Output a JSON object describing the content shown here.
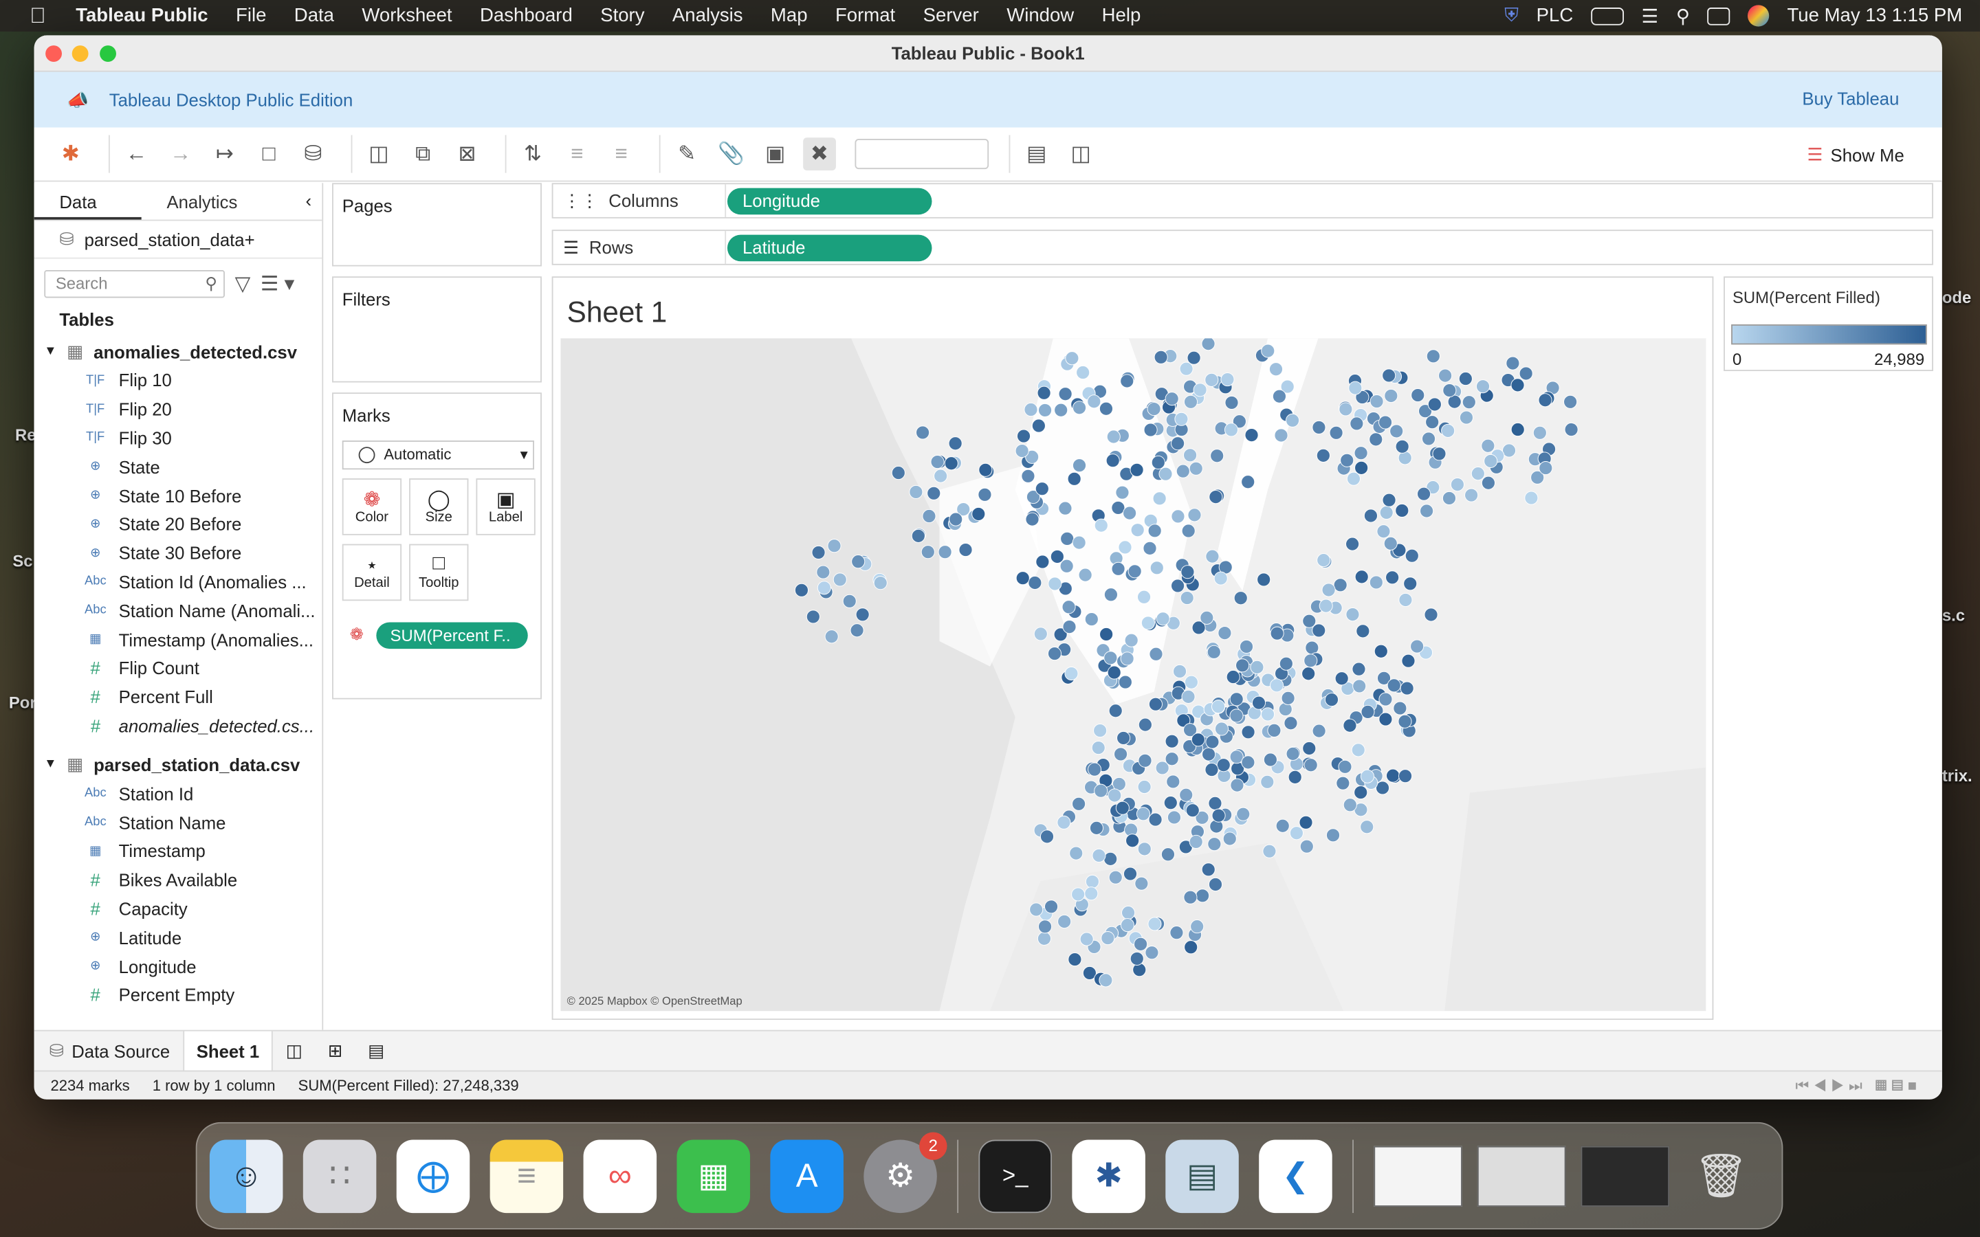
{
  "menubar": {
    "app_name": "Tableau Public",
    "items": [
      "File",
      "Data",
      "Worksheet",
      "Dashboard",
      "Story",
      "Analysis",
      "Map",
      "Format",
      "Server",
      "Window",
      "Help"
    ],
    "vpn_label": "PLC",
    "clock": "Tue May 13  1:15 PM"
  },
  "desktop_fragments": [
    "ode",
    "Re",
    "Sc",
    "s.c",
    "Por",
    "trix."
  ],
  "window": {
    "title": "Tableau Public - Book1",
    "banner_text": "Tableau Desktop Public Edition",
    "buy_label": "Buy Tableau",
    "show_me_label": "Show Me"
  },
  "data_pane": {
    "tabs": [
      "Data",
      "Analytics"
    ],
    "datasource": "parsed_station_data+",
    "search_placeholder": "Search",
    "tables_heading": "Tables",
    "tables": [
      {
        "name": "anomalies_detected.csv",
        "fields": [
          {
            "type": "T|F",
            "label": "Flip 10"
          },
          {
            "type": "T|F",
            "label": "Flip 20"
          },
          {
            "type": "T|F",
            "label": "Flip 30"
          },
          {
            "type": "geo",
            "label": "State"
          },
          {
            "type": "geo",
            "label": "State 10 Before"
          },
          {
            "type": "geo",
            "label": "State 20 Before"
          },
          {
            "type": "geo",
            "label": "State 30 Before"
          },
          {
            "type": "Abc",
            "label": "Station Id (Anomalies ..."
          },
          {
            "type": "Abc",
            "label": "Station Name (Anomali..."
          },
          {
            "type": "date",
            "label": "Timestamp (Anomalies..."
          },
          {
            "type": "#",
            "label": "Flip Count"
          },
          {
            "type": "#",
            "label": "Percent Full"
          },
          {
            "type": "#",
            "label": "anomalies_detected.cs..."
          }
        ]
      },
      {
        "name": "parsed_station_data.csv",
        "fields": [
          {
            "type": "Abc",
            "label": "Station Id"
          },
          {
            "type": "Abc",
            "label": "Station Name"
          },
          {
            "type": "date",
            "label": "Timestamp"
          },
          {
            "type": "#",
            "label": "Bikes Available"
          },
          {
            "type": "#",
            "label": "Capacity"
          },
          {
            "type": "geo",
            "label": "Latitude"
          },
          {
            "type": "geo",
            "label": "Longitude"
          },
          {
            "type": "#",
            "label": "Percent Empty"
          }
        ]
      }
    ]
  },
  "cards": {
    "pages": "Pages",
    "filters": "Filters",
    "marks": "Marks",
    "mark_type": "Automatic",
    "mark_buttons": [
      "Color",
      "Size",
      "Label",
      "Detail",
      "Tooltip"
    ],
    "color_pill": "SUM(Percent F.."
  },
  "shelves": {
    "columns_label": "Columns",
    "columns_pill": "Longitude",
    "rows_label": "Rows",
    "rows_pill": "Latitude"
  },
  "view": {
    "sheet_title": "Sheet 1",
    "attribution": "© 2025 Mapbox © OpenStreetMap"
  },
  "legend": {
    "title": "SUM(Percent Filled)",
    "min": "0",
    "max": "24,989",
    "color_low": "#b8d6ee",
    "color_high": "#2d5f94"
  },
  "sheet_tabs": {
    "data_source": "Data Source",
    "active_sheet": "Sheet 1"
  },
  "status": {
    "marks": "2234 marks",
    "dims": "1 row by 1 column",
    "sum": "SUM(Percent Filled): 27,248,339"
  },
  "dock": {
    "apps": [
      "Finder",
      "Launchpad",
      "Safari",
      "Notes",
      "Freeform",
      "Numbers",
      "App Store",
      "System Settings",
      "Terminal",
      "Tableau",
      "Preview",
      "Visual Studio Code"
    ],
    "settings_badge": "2"
  }
}
